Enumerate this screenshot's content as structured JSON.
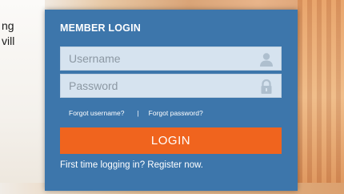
{
  "background": {
    "text_lines": [
      "ng",
      "vill"
    ]
  },
  "login_panel": {
    "title": "MEMBER LOGIN",
    "username": {
      "placeholder": "Username",
      "value": ""
    },
    "password": {
      "placeholder": "Password",
      "value": ""
    },
    "forgot_username": "Forgot username?",
    "separator": "|",
    "forgot_password": "Forgot password?",
    "login_button": "LOGIN",
    "register_text": "First time logging in? Register now."
  },
  "colors": {
    "panel": "#3d76ab",
    "input_bg": "#d6e3ef",
    "button": "#f0641e",
    "text": "#ffffff"
  },
  "icons": [
    "user-icon",
    "lock-icon"
  ]
}
